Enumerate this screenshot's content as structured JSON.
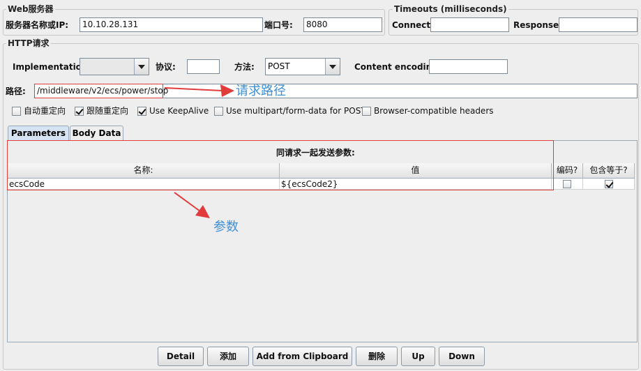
{
  "web_server": {
    "legend": "Web服务器",
    "server_label": "服务器名称或IP:",
    "server_value": "10.10.28.131",
    "port_label": "端口号:",
    "port_value": "8080"
  },
  "timeouts": {
    "legend": "Timeouts (milliseconds)",
    "connect_label": "Connect:",
    "connect_value": "",
    "response_label": "Response:",
    "response_value": ""
  },
  "http_request": {
    "legend": "HTTP请求",
    "implementation_label": "Implementation:",
    "implementation_value": "",
    "protocol_label": "协议:",
    "protocol_value": "",
    "method_label": "方法:",
    "method_value": "POST",
    "encoding_label": "Content encoding:",
    "encoding_value": "",
    "path_label": "路径:",
    "path_value": "/middleware/v2/ecs/power/stop"
  },
  "options": [
    {
      "label": "自动重定向",
      "checked": false
    },
    {
      "label": "跟随重定向",
      "checked": true
    },
    {
      "label": "Use KeepAlive",
      "checked": true
    },
    {
      "label": "Use multipart/form-data for POST",
      "checked": false
    },
    {
      "label": "Browser-compatible headers",
      "checked": false
    }
  ],
  "tabs": [
    {
      "label": "Parameters",
      "active": true
    },
    {
      "label": "Body Data",
      "active": false
    }
  ],
  "params_table": {
    "title": "同请求一起发送参数:",
    "columns": [
      "名称:",
      "值",
      "编码?",
      "包含等于?"
    ],
    "rows": [
      {
        "name": "ecsCode",
        "value": "${ecsCode2}",
        "encode": false,
        "include_equals": true
      }
    ]
  },
  "buttons": {
    "detail": "Detail",
    "add": "添加",
    "add_clipboard": "Add from Clipboard",
    "delete": "删除",
    "up": "Up",
    "down": "Down"
  },
  "annotations": {
    "path_note": "请求路径",
    "params_note": "参数",
    "color": "#3d8fd6",
    "arrow_color": "#e23b3b"
  }
}
